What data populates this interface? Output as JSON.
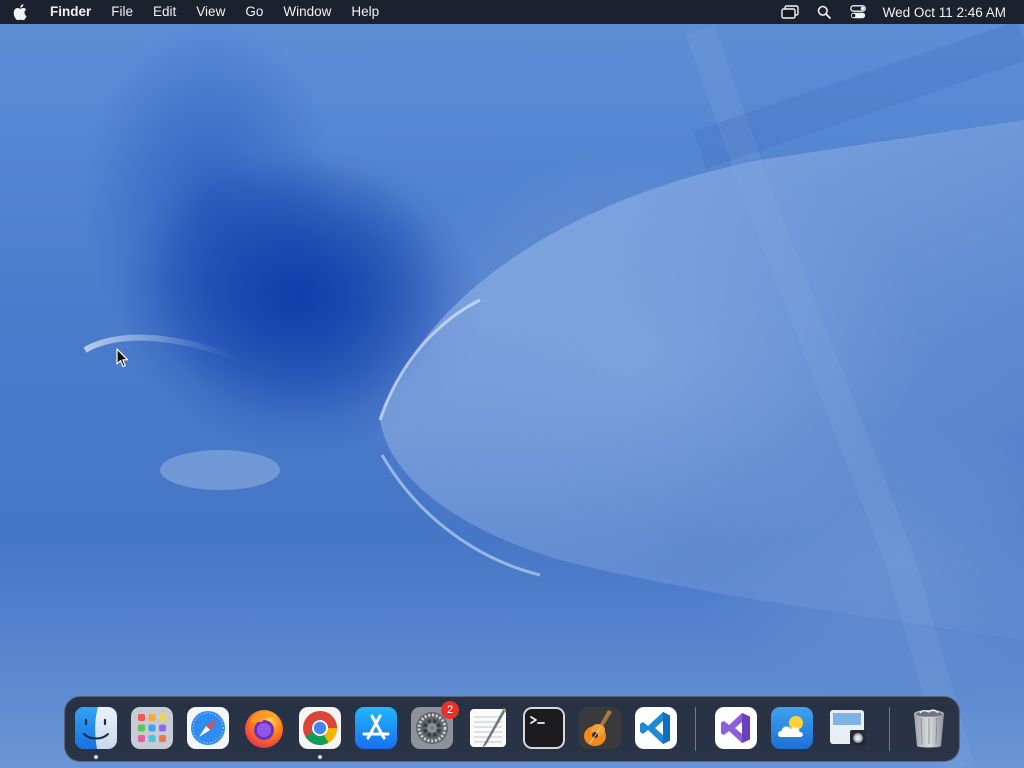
{
  "menubar": {
    "app_name": "Finder",
    "menus": [
      "File",
      "Edit",
      "View",
      "Go",
      "Window",
      "Help"
    ],
    "clock": "Wed Oct 11  2:46 AM",
    "status_icons": [
      "screen-mirroring-icon",
      "spotlight-search-icon",
      "control-center-icon"
    ]
  },
  "dock": {
    "items": [
      {
        "name": "finder",
        "icon": "finder-icon",
        "running": true
      },
      {
        "name": "launchpad",
        "icon": "launchpad-icon",
        "running": false
      },
      {
        "name": "safari",
        "icon": "safari-icon",
        "running": false
      },
      {
        "name": "firefox",
        "icon": "firefox-icon",
        "running": false
      },
      {
        "name": "chrome",
        "icon": "chrome-icon",
        "running": true
      },
      {
        "name": "app-store",
        "icon": "app-store-icon",
        "running": false
      },
      {
        "name": "system-settings",
        "icon": "system-settings-icon",
        "running": false,
        "badge": "2"
      },
      {
        "name": "textedit",
        "icon": "textedit-icon",
        "running": false
      },
      {
        "name": "terminal",
        "icon": "terminal-icon",
        "running": false
      },
      {
        "name": "garageband",
        "icon": "garageband-icon",
        "running": false
      },
      {
        "name": "vscode",
        "icon": "vscode-icon",
        "running": false
      },
      {
        "name": "visual-studio",
        "icon": "visual-studio-icon",
        "running": false
      },
      {
        "name": "weather",
        "icon": "weather-icon",
        "running": false
      },
      {
        "name": "preview",
        "icon": "preview-icon",
        "running": false
      },
      {
        "name": "trash",
        "icon": "trash-icon",
        "running": false
      }
    ]
  },
  "colors": {
    "menubar_bg": "#16181e",
    "badge": "#e5332a",
    "wallpaper_primary": "#4a78c4"
  }
}
